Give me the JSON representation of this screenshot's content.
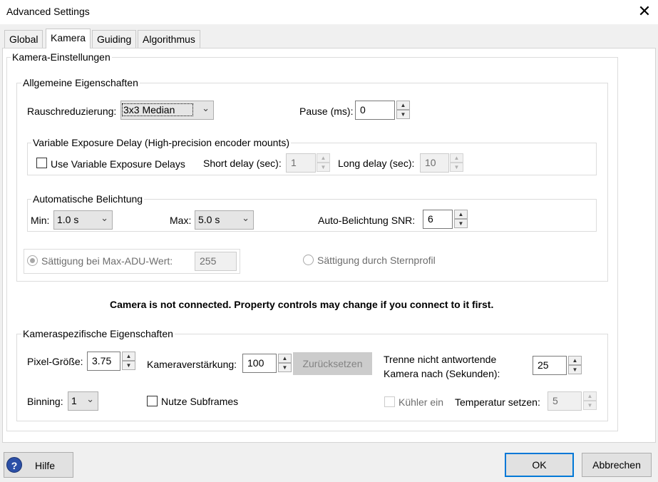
{
  "window": {
    "title": "Advanced Settings",
    "close_glyph": "✕"
  },
  "tabs": [
    {
      "label": "Global",
      "active": false
    },
    {
      "label": "Kamera",
      "active": true
    },
    {
      "label": "Guiding",
      "active": false
    },
    {
      "label": "Algorithmus",
      "active": false
    }
  ],
  "camera_settings": {
    "group_label": "Kamera-Einstellungen",
    "general": {
      "group_label": "Allgemeine Eigenschaften",
      "noise_reduction": {
        "label": "Rauschreduzierung:",
        "value": "3x3 Median"
      },
      "pause": {
        "label": "Pause (ms):",
        "value": "0"
      },
      "variable_exposure": {
        "group_label": "Variable Exposure Delay (High-precision encoder mounts)",
        "use_checkbox": {
          "label": "Use Variable Exposure Delays",
          "checked": false
        },
        "short_delay": {
          "label": "Short delay (sec):",
          "value": "1"
        },
        "long_delay": {
          "label": "Long delay (sec):",
          "value": "10"
        }
      },
      "auto_exposure": {
        "group_label": "Automatische Belichtung",
        "min": {
          "label": "Min:",
          "value": "1.0 s"
        },
        "max": {
          "label": "Max:",
          "value": "5.0 s"
        },
        "snr": {
          "label": "Auto-Belichtung SNR:",
          "value": "6"
        }
      },
      "saturation_adu": {
        "label": "Sättigung bei Max-ADU-Wert:",
        "value": "255",
        "selected": true
      },
      "saturation_star": {
        "label": "Sättigung durch Sternprofil",
        "selected": false
      }
    },
    "warning": "Camera is not connected.  Property controls may change if you connect to it first.",
    "specific": {
      "group_label": "Kameraspezifische Eigenschaften",
      "pixel_size": {
        "label": "Pixel-Größe:",
        "value": "3.75"
      },
      "gain": {
        "label": "Kameraverstärkung:",
        "value": "100"
      },
      "reset_button": "Zurücksetzen",
      "disconnect": {
        "label_line1": "Trenne nicht antwortende",
        "label_line2": "Kamera nach (Sekunden):",
        "value": "25"
      },
      "binning": {
        "label": "Binning:",
        "value": "1"
      },
      "subframes": {
        "label": "Nutze Subframes",
        "checked": false
      },
      "cooler": {
        "label": "Kühler ein",
        "checked": false
      },
      "temperature": {
        "label": "Temperatur setzen:",
        "value": "5"
      }
    }
  },
  "footer": {
    "help": "Hilfe",
    "help_icon": "?",
    "ok": "OK",
    "cancel": "Abbrechen"
  }
}
